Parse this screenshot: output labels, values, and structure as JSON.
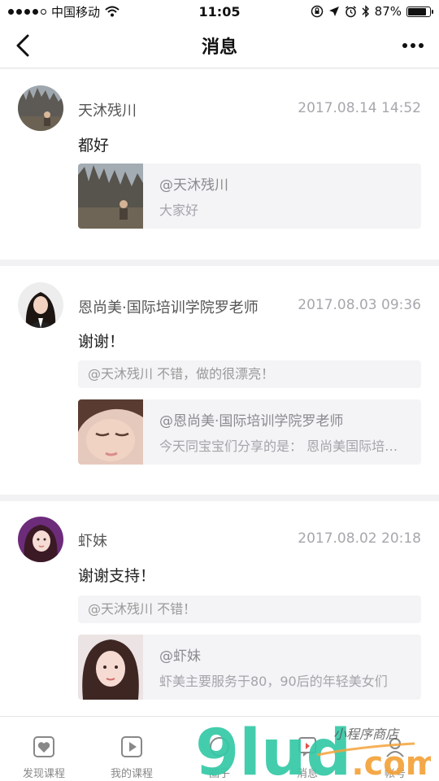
{
  "status_bar": {
    "carrier": "中国移动",
    "time": "11:05",
    "battery": "87%"
  },
  "nav": {
    "title": "消息"
  },
  "messages": [
    {
      "username": "天沐残川",
      "timestamp": "2017.08.14 14:52",
      "text": "都好",
      "quote": "",
      "ref_author": "@天沐残川",
      "ref_snippet": "大家好"
    },
    {
      "username": "恩尚美·国际培训学院罗老师",
      "timestamp": "2017.08.03 09:36",
      "text": "谢谢！",
      "quote": "@天沐残川 不错，做的很漂亮！",
      "ref_author": "@恩尚美·国际培训学院罗老师",
      "ref_snippet": "今天同宝宝们分享的是： 恩尚美国际培训学院"
    },
    {
      "username": "虾妹",
      "timestamp": "2017.08.02 20:18",
      "text": "谢谢支持！",
      "quote": "@天沐残川 不错！",
      "ref_author": "@虾妹",
      "ref_snippet": "虾美主要服务于80，90后的年轻美女们"
    }
  ],
  "tabs": [
    {
      "label": "发现课程",
      "icon": "heart-box-icon"
    },
    {
      "label": "我的课程",
      "icon": "play-box-icon"
    },
    {
      "label": "圈子",
      "icon": "circle-icon"
    },
    {
      "label": "消息",
      "icon": "message-icon"
    },
    {
      "label": "帐号",
      "icon": "account-icon"
    }
  ],
  "watermark": {
    "text": "9lud.com",
    "tagline": "小程序商店"
  },
  "colors": {
    "accent_green": "#35c9a7",
    "watermark_orange": "#f4a23a",
    "tab_inactive": "#888888"
  }
}
